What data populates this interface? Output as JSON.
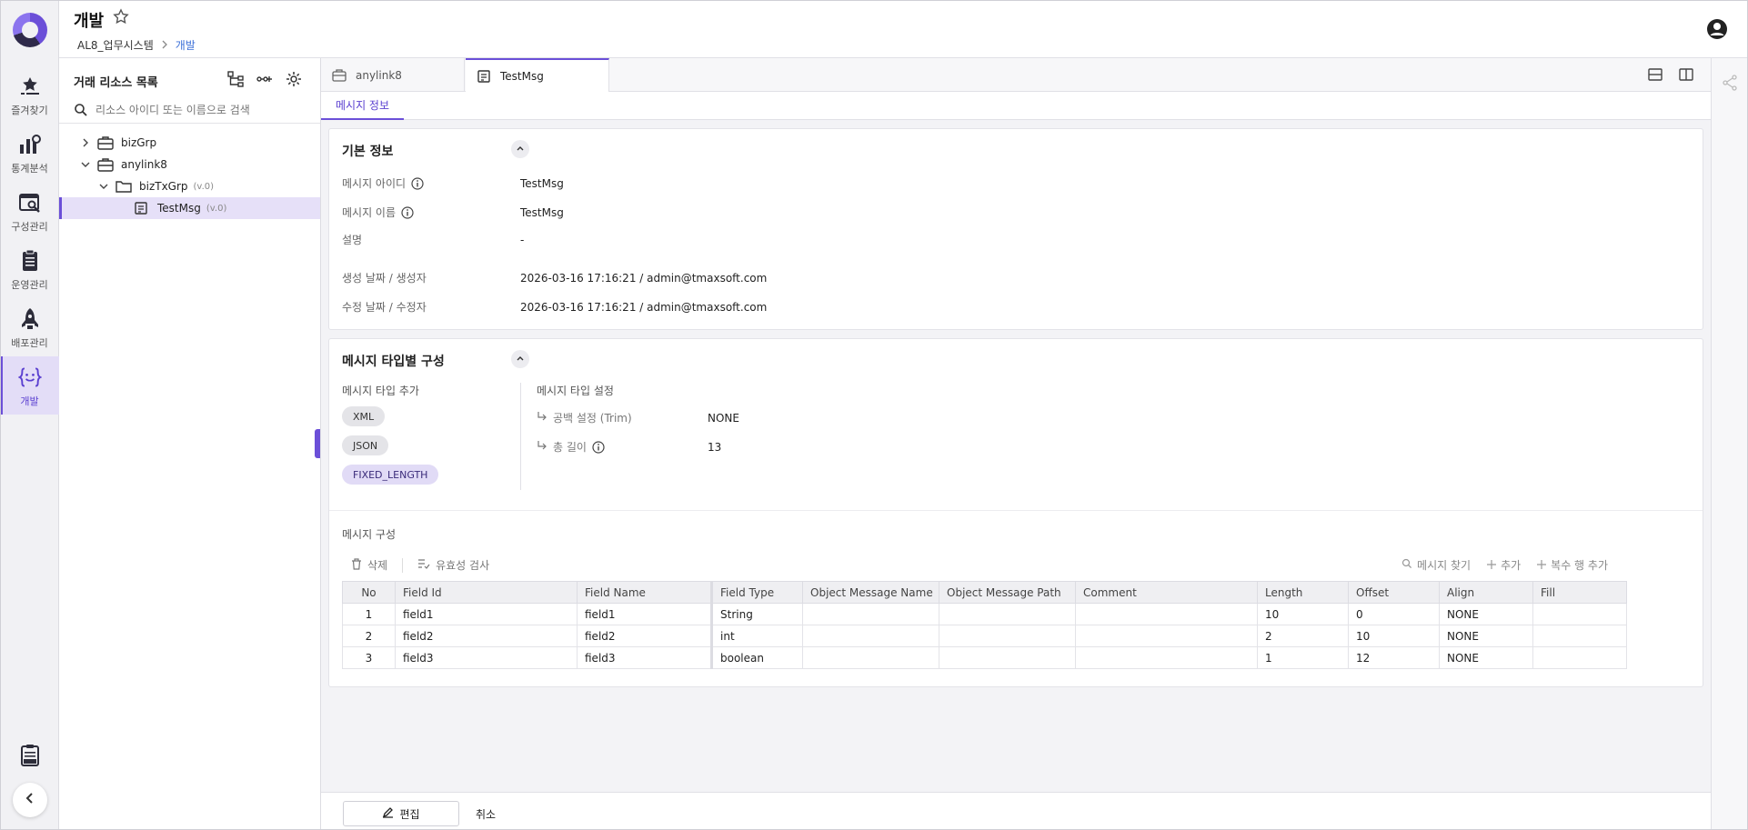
{
  "header": {
    "title": "개발",
    "breadcrumb": [
      "AL8_업무시스템",
      "개발"
    ]
  },
  "rail": {
    "items": [
      {
        "label": "즐겨찾기",
        "icon": "star-list-icon"
      },
      {
        "label": "통계분석",
        "icon": "chart-icon"
      },
      {
        "label": "구성관리",
        "icon": "config-icon"
      },
      {
        "label": "운영관리",
        "icon": "clipboard-icon"
      },
      {
        "label": "배포관리",
        "icon": "rocket-icon"
      },
      {
        "label": "개발",
        "icon": "code-brace-icon"
      }
    ],
    "active": "개발"
  },
  "tree": {
    "title": "거래 리소스 목록",
    "search_placeholder": "리소스 아이디 또는 이름으로 검색",
    "nodes": [
      {
        "label": "bizGrp",
        "version": ""
      },
      {
        "label": "anylink8",
        "version": ""
      },
      {
        "label": "bizTxGrp",
        "version": "(v.0)"
      },
      {
        "label": "TestMsg",
        "version": "(v.0)"
      }
    ]
  },
  "tabs": [
    {
      "label": "anylink8"
    },
    {
      "label": "TestMsg"
    }
  ],
  "subtabs": [
    {
      "label": "메시지 정보"
    }
  ],
  "basic_info": {
    "title": "기본 정보",
    "fields": [
      {
        "label": "메시지 아이디",
        "value": "TestMsg"
      },
      {
        "label": "메시지 이름",
        "value": "TestMsg"
      },
      {
        "label": "설명",
        "value": "-"
      },
      {
        "label": "생성 날짜 / 생성자",
        "value": "2026-03-16 17:16:21 / admin@tmaxsoft.com"
      },
      {
        "label": "수정 날짜 / 수정자",
        "value": "2026-03-16 17:16:21 / admin@tmaxsoft.com"
      }
    ]
  },
  "msg_type": {
    "title": "메시지 타입별 구성",
    "add_label": "메시지 타입 추가",
    "settings_label": "메시지 타입 설정",
    "types": [
      "XML",
      "JSON",
      "FIXED_LENGTH"
    ],
    "active_type": "FIXED_LENGTH",
    "settings": [
      {
        "label": "공백 설정 (Trim)",
        "value": "NONE"
      },
      {
        "label": "총 길이",
        "value": "13"
      }
    ]
  },
  "msg_struct": {
    "title": "메시지 구성",
    "toolbar": {
      "delete": "삭제",
      "validate": "유효성 검사",
      "find": "메시지 찾기",
      "add": "추가",
      "add_multi": "복수 행 추가"
    },
    "columns": [
      "No",
      "Field Id",
      "Field Name",
      "Field Type",
      "Object Message Name",
      "Object Message Path",
      "Comment",
      "Length",
      "Offset",
      "Align",
      "Fill"
    ],
    "rows": [
      [
        "1",
        "field1",
        "field1",
        "String",
        "",
        "",
        "",
        "10",
        "0",
        "NONE",
        ""
      ],
      [
        "2",
        "field2",
        "field2",
        "int",
        "",
        "",
        "",
        "2",
        "10",
        "NONE",
        ""
      ],
      [
        "3",
        "field3",
        "field3",
        "boolean",
        "",
        "",
        "",
        "1",
        "12",
        "NONE",
        ""
      ]
    ]
  },
  "footer": {
    "edit": "편집",
    "cancel": "취소"
  },
  "colors": {
    "accent": "#6b4fd8",
    "selected_bg": "#e6e0f8",
    "link": "#3b6fd8"
  }
}
